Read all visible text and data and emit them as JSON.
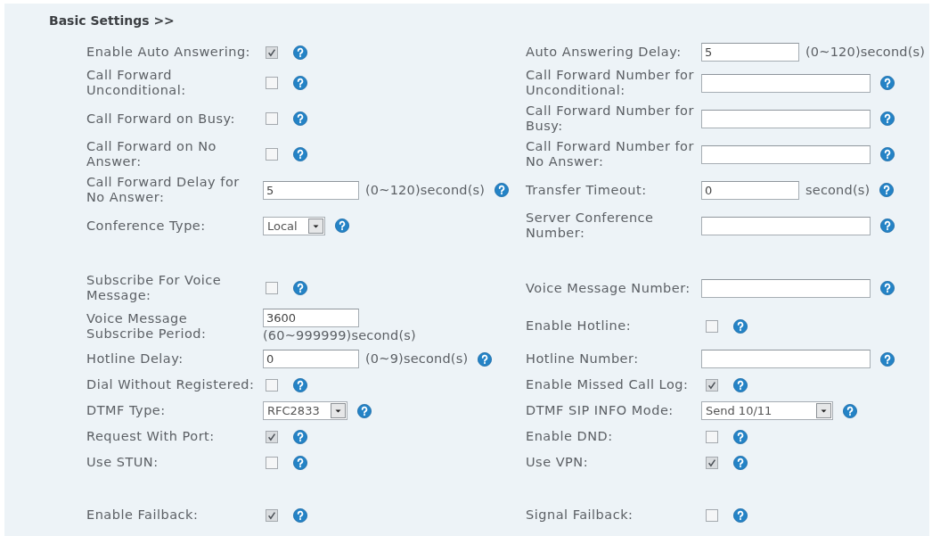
{
  "section": {
    "title": "Basic Settings >>"
  },
  "groups": [
    {
      "rows": [
        {
          "left": {
            "label": "Enable Auto Answering:",
            "kind": "checkbox",
            "checked": true,
            "help": true
          },
          "right": {
            "label": "Auto Answering Delay:",
            "kind": "input",
            "value": "5",
            "unit": "(0~120)second(s)",
            "help": false
          }
        },
        {
          "left": {
            "label": "Call Forward\nUnconditional:",
            "kind": "checkbox",
            "checked": false,
            "help": true
          },
          "right": {
            "label": "Call Forward Number for\nUnconditional:",
            "kind": "input",
            "help": true
          }
        },
        {
          "left": {
            "label": "Call Forward on Busy:",
            "kind": "checkbox",
            "checked": false,
            "help": true
          },
          "right": {
            "label": "Call Forward Number for\nBusy:",
            "kind": "input",
            "help": true
          }
        },
        {
          "left": {
            "label": "Call Forward on No\nAnswer:",
            "kind": "checkbox",
            "checked": false,
            "help": true
          },
          "right": {
            "label": "Call Forward Number for\nNo Answer:",
            "kind": "input",
            "help": true
          }
        },
        {
          "left": {
            "label": "Call Forward Delay for\nNo Answer:",
            "kind": "input",
            "value": "5",
            "unit": "(0~120)second(s)",
            "help": true
          },
          "right": {
            "label": "Transfer Timeout:",
            "kind": "input",
            "value": "0",
            "unit": "second(s)",
            "help": true
          }
        },
        {
          "left": {
            "label": "Conference Type:",
            "kind": "select",
            "value": "Local",
            "help": true
          },
          "right": {
            "label": "Server Conference\nNumber:",
            "kind": "input",
            "help": true
          }
        }
      ]
    },
    {
      "rows": [
        {
          "left": {
            "label": "Subscribe For Voice\nMessage:",
            "kind": "checkbox",
            "checked": false,
            "help": true
          },
          "right": {
            "label": "Voice Message Number:",
            "kind": "input",
            "help": true
          }
        },
        {
          "left": {
            "label": "Voice Message\nSubscribe Period:",
            "kind": "input_stacked",
            "value": "3600",
            "unit": "(60~999999)second(s)",
            "help": false
          },
          "right": {
            "label": "Enable Hotline:",
            "kind": "checkbox",
            "checked": false,
            "help": true
          }
        },
        {
          "left": {
            "label": "Hotline Delay:",
            "kind": "input",
            "value": "0",
            "unit": "(0~9)second(s)",
            "help": true
          },
          "right": {
            "label": "Hotline Number:",
            "kind": "input",
            "help": true
          }
        },
        {
          "left": {
            "label": "Dial Without Registered:",
            "kind": "checkbox",
            "checked": false,
            "help": true
          },
          "right": {
            "label": "Enable Missed Call Log:",
            "kind": "checkbox",
            "checked": true,
            "help": true
          }
        },
        {
          "left": {
            "label": "DTMF Type:",
            "kind": "select",
            "value": "RFC2833",
            "help": true
          },
          "right": {
            "label": "DTMF SIP INFO Mode:",
            "kind": "select",
            "value": "Send 10/11",
            "help": true
          }
        },
        {
          "left": {
            "label": "Request With Port:",
            "kind": "checkbox",
            "checked": true,
            "help": true
          },
          "right": {
            "label": "Enable DND:",
            "kind": "checkbox",
            "checked": false,
            "help": true
          }
        },
        {
          "left": {
            "label": "Use STUN:",
            "kind": "checkbox",
            "checked": false,
            "help": true
          },
          "right": {
            "label": "Use VPN:",
            "kind": "checkbox",
            "checked": true,
            "help": true
          }
        }
      ]
    },
    {
      "rows": [
        {
          "left": {
            "label": "Enable Failback:",
            "kind": "checkbox",
            "checked": true,
            "help": true
          },
          "right": {
            "label": "Signal Failback:",
            "kind": "checkbox",
            "checked": false,
            "help": true
          }
        }
      ]
    }
  ]
}
